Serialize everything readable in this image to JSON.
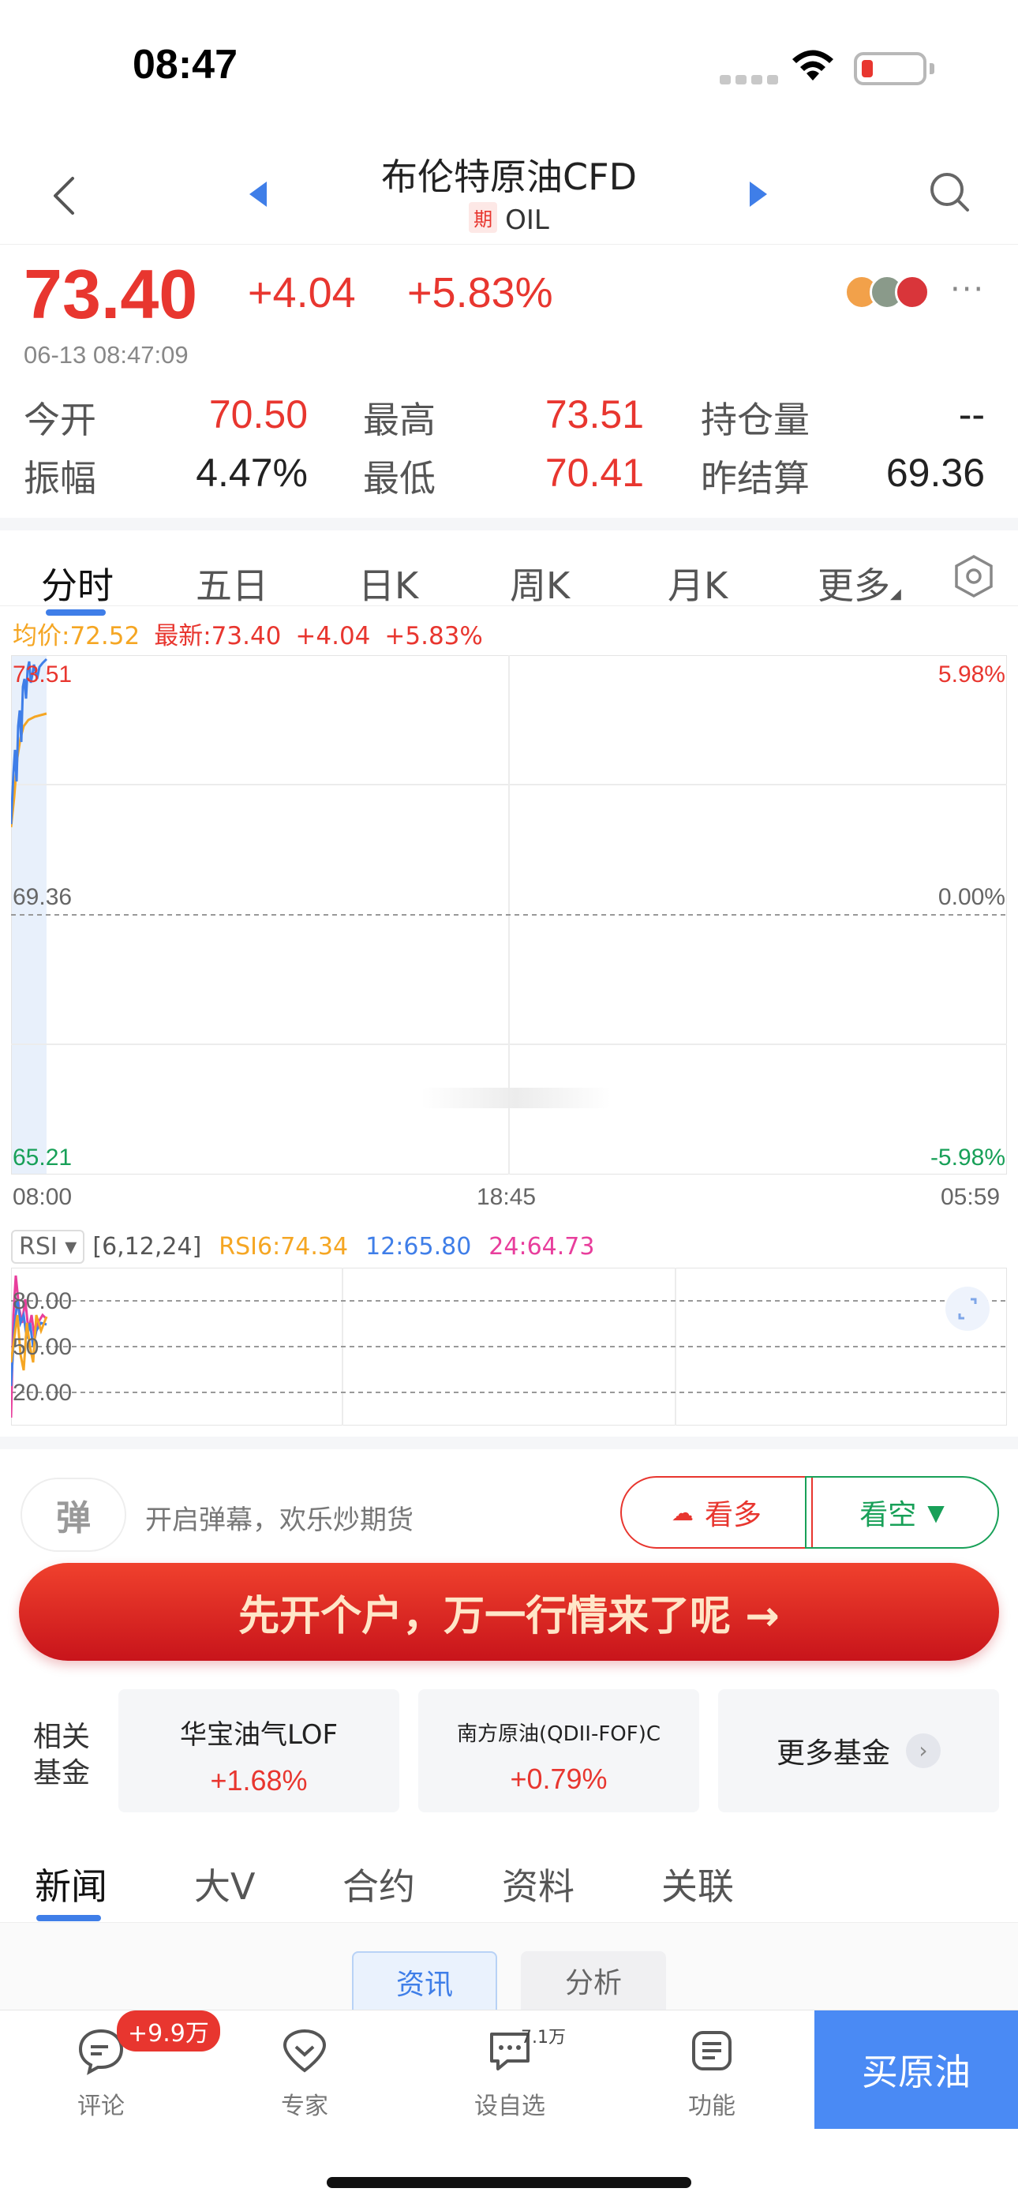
{
  "status_bar": {
    "time": "08:47"
  },
  "nav": {
    "title": "布伦特原油CFD",
    "futures_tag": "期",
    "symbol": "OIL"
  },
  "quote": {
    "price": "73.40",
    "change": "+4.04",
    "change_pct": "+5.83%",
    "timestamp": "06-13 08:47:09",
    "more": "···"
  },
  "stats": [
    {
      "label": "今开",
      "value": "70.50",
      "color": "#e8362f"
    },
    {
      "label": "最高",
      "value": "73.51",
      "color": "#e8362f"
    },
    {
      "label": "持仓量",
      "value": "--",
      "color": "#222222"
    },
    {
      "label": "振幅",
      "value": "4.47%",
      "color": "#222222"
    },
    {
      "label": "最低",
      "value": "70.41",
      "color": "#e8362f"
    },
    {
      "label": "昨结算",
      "value": "69.36",
      "color": "#222222"
    }
  ],
  "chart_tabs": [
    "分时",
    "五日",
    "日K",
    "周K",
    "月K",
    "更多"
  ],
  "legend": {
    "avg": "均价:72.52",
    "latest": "最新:73.40",
    "change": "+4.04",
    "change_pct": "+5.83%"
  },
  "chart": {
    "y_top": "73.51",
    "y_mid": "69.36",
    "y_bottom": "65.21",
    "pct_top": "5.98%",
    "pct_mid": "0.00%",
    "pct_bottom": "-5.98%",
    "x_start": "08:00",
    "x_mid": "18:45",
    "x_end": "05:59"
  },
  "rsi": {
    "chip": "RSI",
    "params": "[6,12,24]",
    "rsi6": "RSI6:74.34",
    "rsi12": "12:65.80",
    "rsi24": "24:64.73",
    "levels": [
      "80.00",
      "50.00",
      "20.00"
    ]
  },
  "barrage": {
    "placeholder": "开启弹幕，欢乐炒期货",
    "bull": "看多",
    "bear": "看空"
  },
  "banner": {
    "text": "先开个户，万一行情来了呢 →"
  },
  "funds": {
    "label_line1": "相关",
    "label_line2": "基金",
    "items": [
      {
        "name": "华宝油气LOF",
        "pct": "+1.68%"
      },
      {
        "name": "南方原油(QDII-FOF)C",
        "pct": "+0.79%"
      }
    ],
    "more": "更多基金"
  },
  "news_tabs": [
    "新闻",
    "大V",
    "合约",
    "资料",
    "关联"
  ],
  "sub_tabs": [
    "资讯",
    "分析"
  ],
  "bottom_bar": {
    "comment_label": "评论",
    "comment_badge": "+9.9万",
    "expert_label": "专家",
    "watch_label": "设自选",
    "watch_count": "7.1万",
    "func_label": "功能",
    "buy_label": "买原油"
  },
  "colors": {
    "up": "#e8362f",
    "down": "#18a058",
    "accent": "#3f7ee8",
    "avg_line": "#f5a623"
  }
}
